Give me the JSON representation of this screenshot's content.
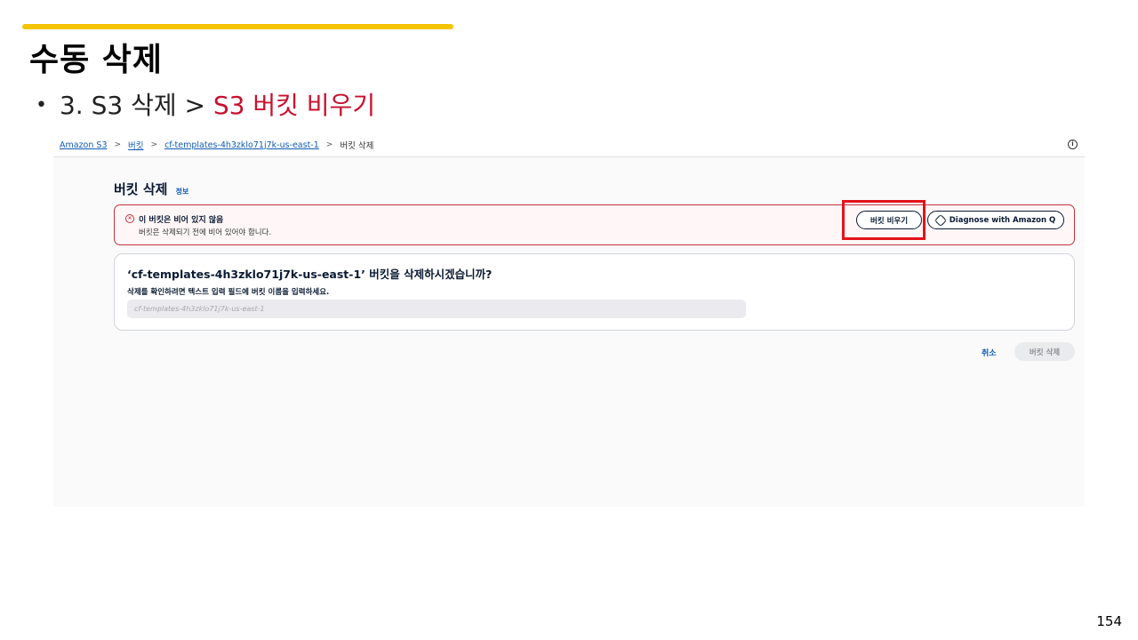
{
  "slide": {
    "title": "수동 삭제",
    "bullet_prefix": "3. S3 삭제 >",
    "bullet_highlight": "S3 버킷 비우기",
    "page_number": "154"
  },
  "breadcrumb": {
    "items": [
      "Amazon S3",
      "버킷",
      "cf-templates-4h3zklo71j7k-us-east-1"
    ],
    "current": "버킷 삭제"
  },
  "page": {
    "heading": "버킷 삭제",
    "info_label": "정보"
  },
  "alert": {
    "title": "이 버킷은 비어 있지 않음",
    "body": "버킷은 삭제되기 전에 비어 있어야 합니다.",
    "empty_button": "버킷 비우기",
    "diagnose_button": "Diagnose with Amazon Q",
    "color": "#c2323d"
  },
  "confirm": {
    "question": "‘cf-templates-4h3zklo71j7k-us-east-1’ 버킷을 삭제하시겠습니까?",
    "instruction": "삭제를 확인하려면 텍스트 입력 필드에 버킷 이름을 입력하세요.",
    "placeholder": "cf-templates-4h3zklo71j7k-us-east-1",
    "value": ""
  },
  "footer": {
    "cancel": "취소",
    "delete": "버킷 삭제"
  },
  "colors": {
    "accent_bar": "#f5c400",
    "highlight": "#c8102e",
    "link": "#0f5bb5",
    "annotation_box": "#e3131b"
  }
}
